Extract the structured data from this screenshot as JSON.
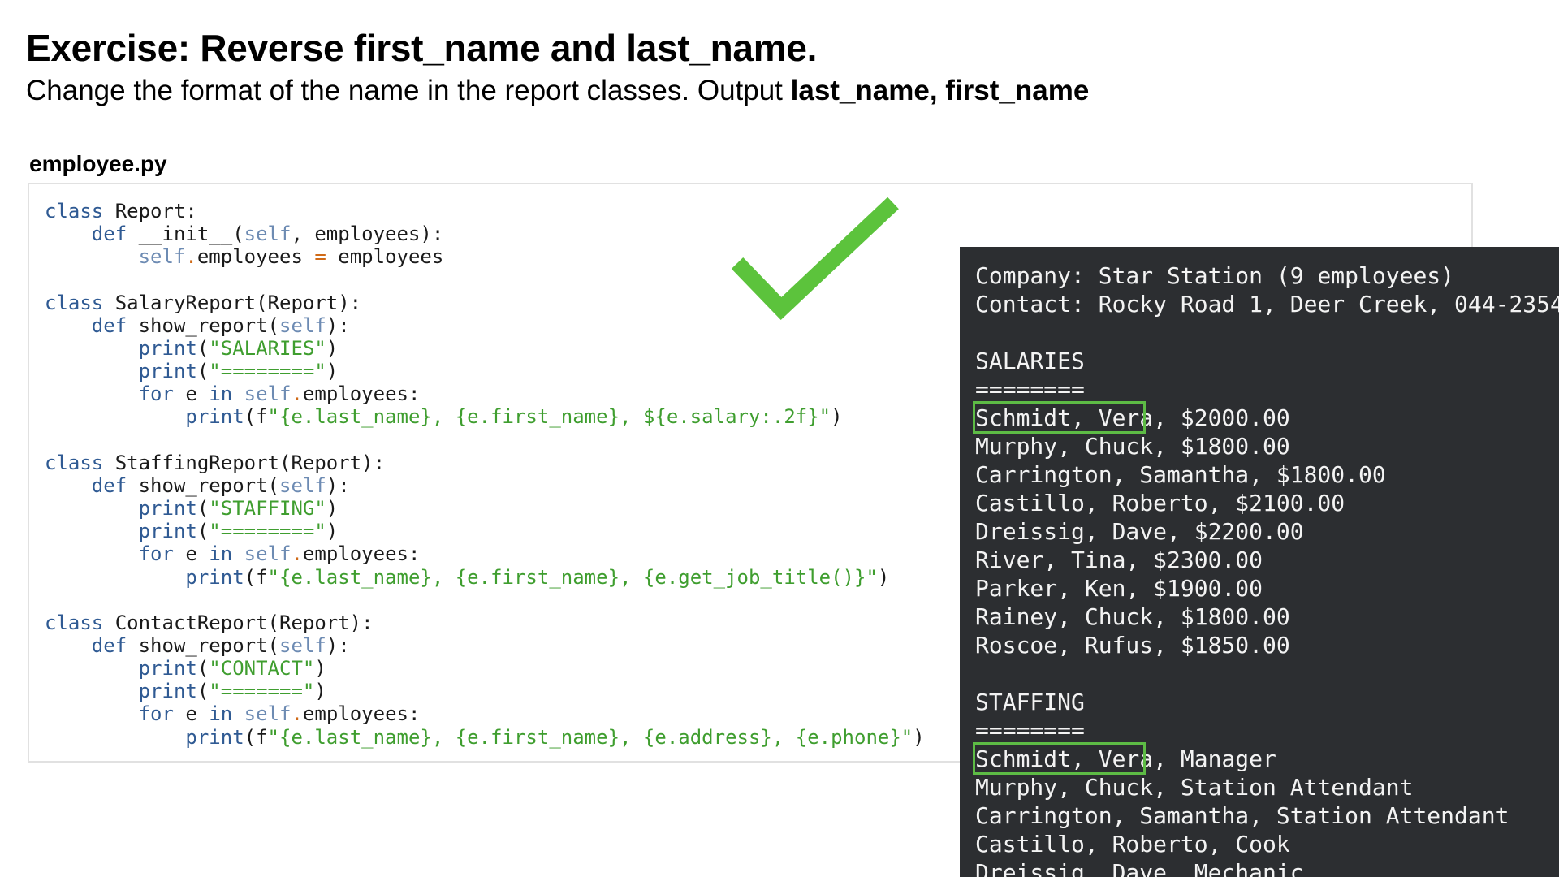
{
  "slide": {
    "title": "Exercise: Reverse first_name and last_name.",
    "subtitle_prefix": "Change the format of the name in the report classes. Output ",
    "subtitle_bold": "last_name, first_name"
  },
  "file": {
    "name": "employee.py"
  },
  "code": {
    "kw_class": "class",
    "kw_def": "def",
    "kw_for": "for",
    "kw_in": "in",
    "self": "self",
    "dot": ".",
    "eq": "=",
    "print": "print",
    "report_class": " Report:",
    "init_sig_a": " __init__(",
    "init_sig_b": ", employees):",
    "employees_attr": "employees ",
    "employees_val": " employees",
    "salary_class": " SalaryReport(Report):",
    "show_report_sig_a": " show_report(",
    "show_report_sig_b": "):",
    "salaries_str": "\"SALARIES\"",
    "salaries_rule": "\"========\"",
    "for_e": " e ",
    "employees_loop": "employees:",
    "salary_fmt": "\"{e.last_name}, {e.first_name}, ${e.salary:.2f}\"",
    "staffing_class": " StaffingReport(Report):",
    "staffing_str": "\"STAFFING\"",
    "staffing_rule": "\"========\"",
    "staffing_fmt": "\"{e.last_name}, {e.first_name}, {e.get_job_title()}\"",
    "contact_class": " ContactReport(Report):",
    "contact_str": "\"CONTACT\"",
    "contact_rule": "\"=======\"",
    "contact_fmt": "\"{e.last_name}, {e.first_name}, {e.address}, {e.phone}\"",
    "paren_open": "(",
    "paren_close": ")",
    "fparen": "(f",
    "indent1": "    ",
    "indent2": "        ",
    "indent3": "            "
  },
  "output": {
    "lines": [
      "Company: Star Station (9 employees)",
      "Contact: Rocky Road 1, Deer Creek, 044-2354",
      "",
      "SALARIES",
      "========",
      "Schmidt, Vera, $2000.00",
      "Murphy, Chuck, $1800.00",
      "Carrington, Samantha, $1800.00",
      "Castillo, Roberto, $2100.00",
      "Dreissig, Dave, $2200.00",
      "River, Tina, $2300.00",
      "Parker, Ken, $1900.00",
      "Rainey, Chuck, $1800.00",
      "Roscoe, Rufus, $1850.00",
      "",
      "STAFFING",
      "========",
      "Schmidt, Vera, Manager",
      "Murphy, Chuck, Station Attendant",
      "Carrington, Samantha, Station Attendant",
      "Castillo, Roberto, Cook",
      "Dreissig, Dave, Mechanic"
    ]
  },
  "colors": {
    "check": "#5cc33c",
    "terminal_bg": "#2c2e31",
    "highlight": "#5dbb45"
  },
  "icons": {
    "check": "checkmark-icon"
  }
}
